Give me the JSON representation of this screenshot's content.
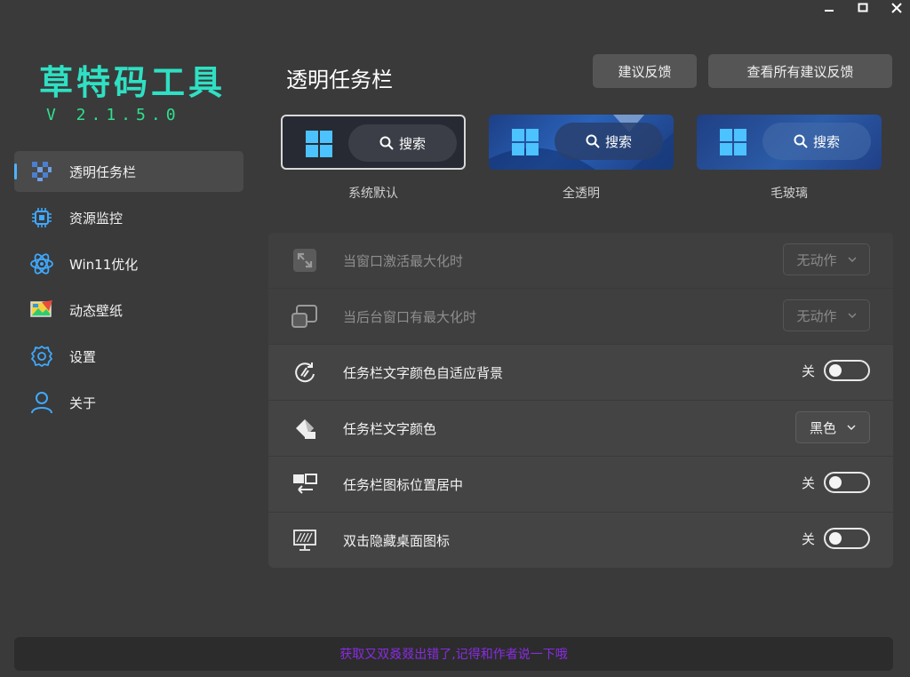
{
  "window": {
    "controls": {
      "minimize_icon": "minimize-icon",
      "maximize_icon": "maximize-icon",
      "close_icon": "close-icon"
    }
  },
  "app": {
    "name": "草特码工具",
    "version": "V 2.1.5.0",
    "accent_color": "#2fe0c3"
  },
  "sidebar": {
    "items": [
      {
        "label": "透明任务栏",
        "icon": "checker-icon",
        "active": true
      },
      {
        "label": "资源监控",
        "icon": "chip-icon",
        "active": false
      },
      {
        "label": "Win11优化",
        "icon": "atom-icon",
        "active": false
      },
      {
        "label": "动态壁纸",
        "icon": "wallpaper-icon",
        "active": false
      },
      {
        "label": "设置",
        "icon": "gear-icon",
        "active": false
      },
      {
        "label": "关于",
        "icon": "user-icon",
        "active": false
      }
    ]
  },
  "header": {
    "title": "透明任务栏",
    "feedback_button": "建议反馈",
    "all_feedback_button": "查看所有建议反馈"
  },
  "presets": [
    {
      "caption": "系统默认",
      "search_label": "搜索",
      "selected": true
    },
    {
      "caption": "全透明",
      "search_label": "搜索",
      "selected": false
    },
    {
      "caption": "毛玻璃",
      "search_label": "搜索",
      "selected": false
    }
  ],
  "settings": [
    {
      "label": "当窗口激活最大化时",
      "control": "dropdown",
      "value": "无动作",
      "disabled": true,
      "icon": "maximize-window-icon"
    },
    {
      "label": "当后台窗口有最大化时",
      "control": "dropdown",
      "value": "无动作",
      "disabled": true,
      "icon": "background-window-icon"
    },
    {
      "label": "任务栏文字颜色自适应背景",
      "control": "toggle",
      "value": "关",
      "disabled": false,
      "icon": "auto-color-icon"
    },
    {
      "label": "任务栏文字颜色",
      "control": "dropdown",
      "value": "黑色",
      "disabled": false,
      "icon": "paint-bucket-icon"
    },
    {
      "label": "任务栏图标位置居中",
      "control": "toggle",
      "value": "关",
      "disabled": false,
      "icon": "center-icons-icon"
    },
    {
      "label": "双击隐藏桌面图标",
      "control": "toggle",
      "value": "关",
      "disabled": false,
      "icon": "desktop-icon"
    }
  ],
  "status": {
    "message": "获取又双叒叕出错了,记得和作者说一下哦",
    "color": "#8a2be2"
  }
}
